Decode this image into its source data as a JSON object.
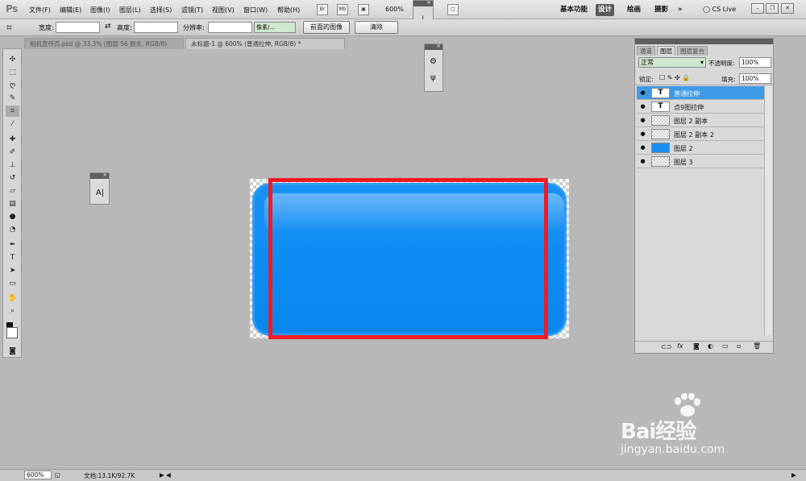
{
  "app": {
    "logo": "Ps"
  },
  "menu": [
    "文件(F)",
    "编辑(E)",
    "图像(I)",
    "图层(L)",
    "选择(S)",
    "滤镜(T)",
    "视图(V)",
    "窗口(W)",
    "帮助(H)"
  ],
  "menubar_extra": {
    "bridge": "Br",
    "mini": "Mb",
    "zoom": "600%"
  },
  "workspaces": {
    "basic": "基本功能",
    "design": "设计",
    "painting": "绘画",
    "photography": "摄影",
    "more": "»",
    "cslive": "CS Live"
  },
  "options": {
    "width_label": "宽度:",
    "height_label": "高度:",
    "resolution_label": "分辨率:",
    "unit_select": "像素/...",
    "front_image": "前面的图像",
    "clear": "清除"
  },
  "tabs": [
    {
      "label": "相机宣传页.psd @ 33.3% (图层 56 副本, RGB/8)"
    },
    {
      "label": "未标题-1 @ 600% (普通拉伸, RGB/8) *"
    }
  ],
  "char_panel": {
    "label": "A|"
  },
  "layers_panel": {
    "tabs": [
      "通道",
      "图层",
      "图层复合"
    ],
    "blend_mode": "正常",
    "opacity_label": "不透明度:",
    "opacity_value": "100%",
    "lock_label": "锁定:",
    "fill_label": "填充:",
    "fill_value": "100%",
    "layers": [
      {
        "name": "普通拉伸",
        "thumb": "T",
        "kind": "text",
        "selected": true
      },
      {
        "name": "点9图拉伸",
        "thumb": "T",
        "kind": "text",
        "selected": false
      },
      {
        "name": "图层 2 副本",
        "thumb": "",
        "kind": "checker",
        "selected": false
      },
      {
        "name": "图层 2 副本 2",
        "thumb": "",
        "kind": "checker",
        "selected": false
      },
      {
        "name": "图层 2",
        "thumb": "",
        "kind": "blue",
        "selected": false
      },
      {
        "name": "图层 3",
        "thumb": "",
        "kind": "checker",
        "selected": false
      }
    ],
    "footer_icons": [
      "link-icon",
      "fx-icon",
      "mask-icon",
      "adjustment-icon",
      "group-icon",
      "new-layer-icon",
      "trash-icon"
    ]
  },
  "status": {
    "zoom": "600%",
    "doc_info": "文档:13.1K/92.7K"
  },
  "watermark": {
    "brand": "Bai经验",
    "url": "jingyan.baidu.com"
  },
  "colors": {
    "accent_blue": "#0c8bf4",
    "highlight_red": "#ee1c24",
    "selected_layer": "#3f9ae6"
  }
}
